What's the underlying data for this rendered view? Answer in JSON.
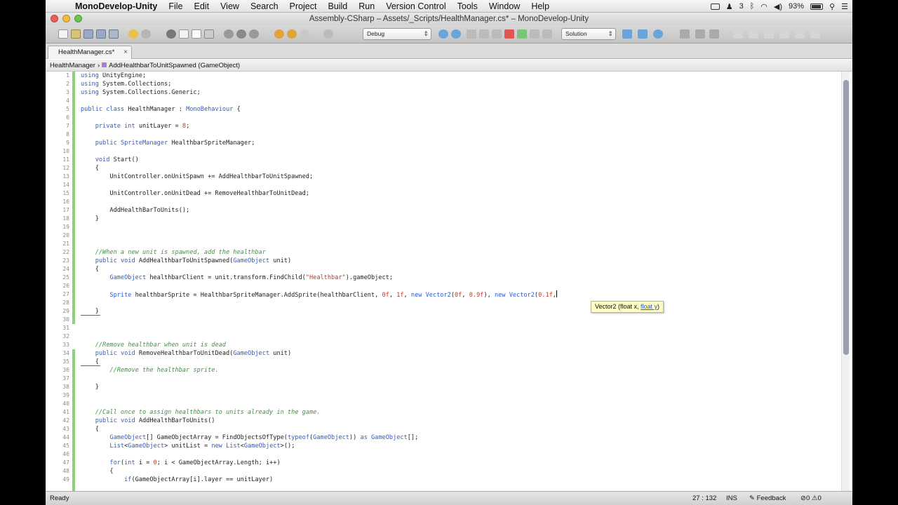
{
  "menubar": {
    "app": "MonoDevelop-Unity",
    "items": [
      "File",
      "Edit",
      "View",
      "Search",
      "Project",
      "Build",
      "Run",
      "Version Control",
      "Tools",
      "Window",
      "Help"
    ],
    "status": {
      "sq_text": "3",
      "battery": "93%"
    }
  },
  "window": {
    "title": "Assembly-CSharp – Assets/_Scripts/HealthManager.cs* – MonoDevelop-Unity"
  },
  "toolbar": {
    "config": "Debug",
    "solution": "Solution"
  },
  "tab": {
    "label": "HealthManager.cs*",
    "close": "×"
  },
  "breadcrumb": {
    "class": "HealthManager",
    "method": "AddHealthbarToUnitSpawned (GameObject)"
  },
  "editor": {
    "lines": [
      {
        "n": "1",
        "code": "using UnityEngine;"
      },
      {
        "n": "2",
        "code": "using System.Collections;"
      },
      {
        "n": "3",
        "code": "using System.Collections.Generic;"
      },
      {
        "n": "4",
        "code": ""
      },
      {
        "n": "5",
        "code": "public class HealthManager : MonoBehaviour {"
      },
      {
        "n": "6",
        "code": ""
      },
      {
        "n": "7",
        "code": "    private int unitLayer = 8;"
      },
      {
        "n": "8",
        "code": ""
      },
      {
        "n": "9",
        "code": "    public SpriteManager HealthbarSpriteManager;"
      },
      {
        "n": "10",
        "code": ""
      },
      {
        "n": "11",
        "code": "    void Start()"
      },
      {
        "n": "12",
        "code": "    {"
      },
      {
        "n": "13",
        "code": "        UnitController.onUnitSpawn += AddHealthbarToUnitSpawned;"
      },
      {
        "n": "14",
        "code": ""
      },
      {
        "n": "15",
        "code": "        UnitController.onUnitDead += RemoveHealthbarToUnitDead;"
      },
      {
        "n": "16",
        "code": ""
      },
      {
        "n": "17",
        "code": "        AddHealthBarToUnits();"
      },
      {
        "n": "18",
        "code": "    }"
      },
      {
        "n": "19",
        "code": ""
      },
      {
        "n": "20",
        "code": ""
      },
      {
        "n": "21",
        "code": ""
      },
      {
        "n": "22",
        "code": "    //When a new unit is spawned, add the healthbar"
      },
      {
        "n": "23",
        "code": "    public void AddHealthbarToUnitSpawned(GameObject unit)"
      },
      {
        "n": "24",
        "code": "    {"
      },
      {
        "n": "25",
        "code": "        GameObject healthbarClient = unit.transform.FindChild(\"Healthbar\").gameObject;"
      },
      {
        "n": "26",
        "code": ""
      },
      {
        "n": "27",
        "code": "        Sprite healthbarSprite = HealthbarSpriteManager.AddSprite(healthbarClient, 0f, 1f, new Vector2(0f, 0.9f), new Vector2(0.1f,"
      },
      {
        "n": "28",
        "code": ""
      },
      {
        "n": "29",
        "code": "    }"
      },
      {
        "n": "30",
        "code": ""
      },
      {
        "n": "31",
        "code": ""
      },
      {
        "n": "32",
        "code": ""
      },
      {
        "n": "33",
        "code": "    //Remove healthbar when unit is dead"
      },
      {
        "n": "34",
        "code": "    public void RemoveHealthbarToUnitDead(GameObject unit)"
      },
      {
        "n": "35",
        "code": "    {"
      },
      {
        "n": "36",
        "code": "        //Remove the healthbar sprite."
      },
      {
        "n": "37",
        "code": ""
      },
      {
        "n": "38",
        "code": "    }"
      },
      {
        "n": "39",
        "code": ""
      },
      {
        "n": "40",
        "code": ""
      },
      {
        "n": "41",
        "code": "    //Call once to assign healthbars to units already in the game."
      },
      {
        "n": "42",
        "code": "    public void AddHealthBarToUnits()"
      },
      {
        "n": "43",
        "code": "    {"
      },
      {
        "n": "44",
        "code": "        GameObject[] GameObjectArray = FindObjectsOfType(typeof(GameObject)) as GameObject[];"
      },
      {
        "n": "45",
        "code": "        List<GameObject> unitList = new List<GameObject>();"
      },
      {
        "n": "46",
        "code": ""
      },
      {
        "n": "47",
        "code": "        for(int i = 0; i < GameObjectArray.Length; i++)"
      },
      {
        "n": "48",
        "code": "        {"
      },
      {
        "n": "49",
        "code": "            if(GameObjectArray[i].layer == unitLayer)"
      }
    ]
  },
  "tooltip": {
    "prefix": "Vector2 (float x, ",
    "param": "float y",
    "suffix": ")"
  },
  "statusbar": {
    "ready": "Ready",
    "position": "27 : 132",
    "mode": "INS",
    "feedback": "Feedback",
    "errors": "0",
    "warnings": "0"
  },
  "colors": {
    "keyword": "#2c5bd4",
    "comment": "#3a9a3a",
    "string": "#c0392b",
    "changebar": "#8fd07a"
  }
}
